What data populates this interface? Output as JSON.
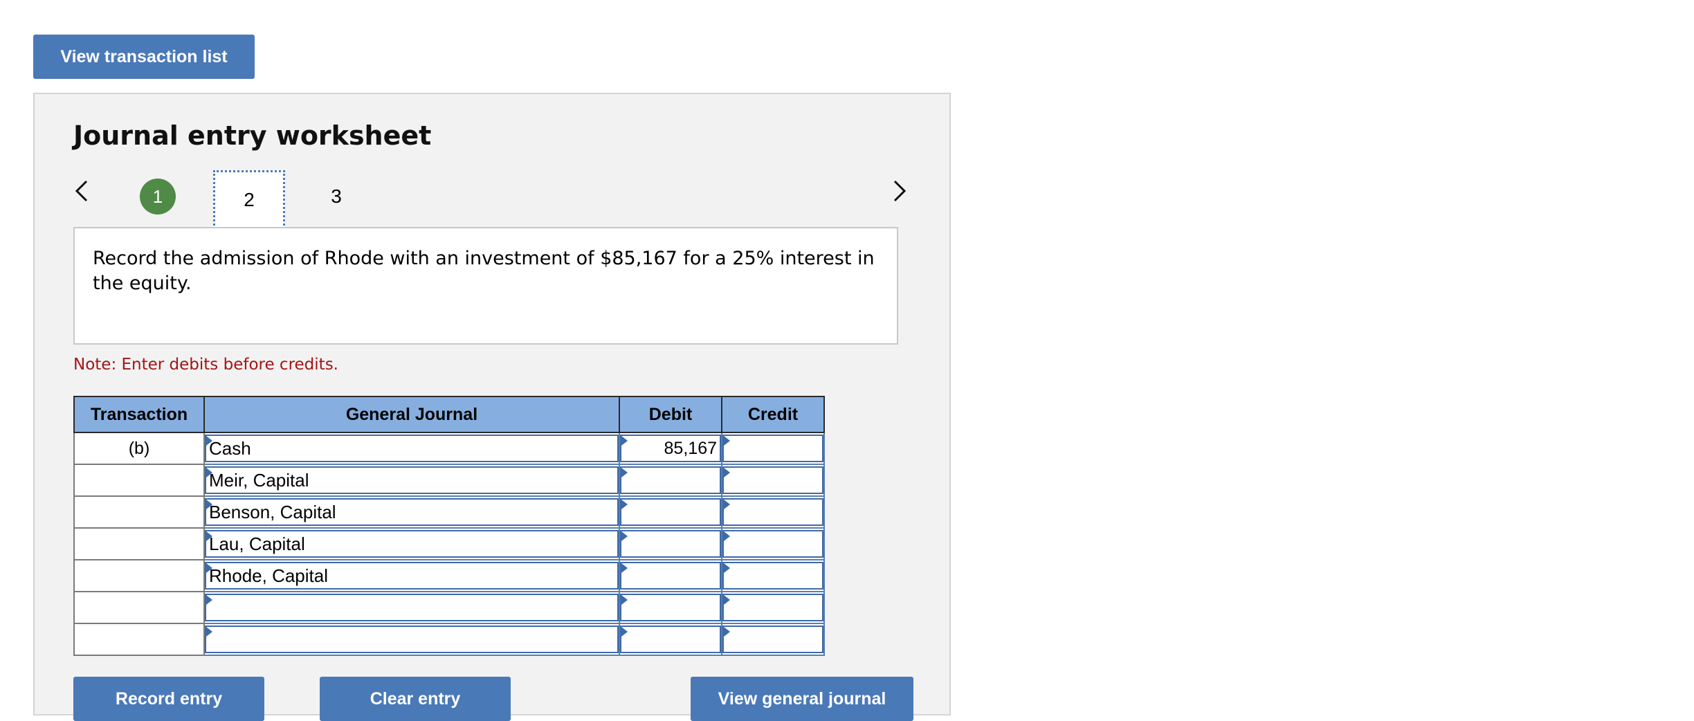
{
  "top": {
    "view_transaction_list_label": "View transaction list"
  },
  "worksheet": {
    "title": "Journal entry worksheet",
    "nav": {
      "prev_icon": "chevron-left-icon",
      "next_icon": "chevron-right-icon"
    },
    "steps": [
      {
        "label": "1",
        "state": "completed"
      },
      {
        "label": "2",
        "state": "current"
      },
      {
        "label": "3",
        "state": "pending"
      }
    ],
    "instructions": "Record the admission of Rhode with an investment of $85,167 for a 25% interest in the equity.",
    "note": "Note: Enter debits before credits.",
    "table": {
      "headers": {
        "transaction": "Transaction",
        "general_journal": "General Journal",
        "debit": "Debit",
        "credit": "Credit"
      },
      "rows": [
        {
          "transaction": "(b)",
          "account": "Cash",
          "debit": "85,167",
          "credit": ""
        },
        {
          "transaction": "",
          "account": "Meir, Capital",
          "debit": "",
          "credit": ""
        },
        {
          "transaction": "",
          "account": "Benson, Capital",
          "debit": "",
          "credit": ""
        },
        {
          "transaction": "",
          "account": "Lau, Capital",
          "debit": "",
          "credit": ""
        },
        {
          "transaction": "",
          "account": "Rhode, Capital",
          "debit": "",
          "credit": ""
        },
        {
          "transaction": "",
          "account": "",
          "debit": "",
          "credit": ""
        },
        {
          "transaction": "",
          "account": "",
          "debit": "",
          "credit": ""
        }
      ]
    },
    "buttons": {
      "record_entry": "Record entry",
      "clear_entry": "Clear entry",
      "view_general_journal": "View general journal"
    }
  },
  "colors": {
    "button_blue": "#4a79b8",
    "header_blue": "#86afe0",
    "step_complete_green": "#4f8b46",
    "note_red": "#a31515"
  }
}
